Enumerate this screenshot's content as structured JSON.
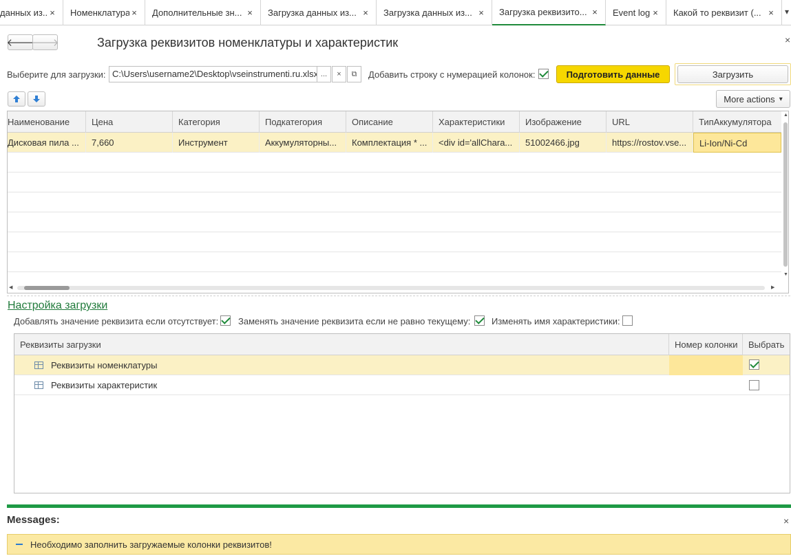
{
  "tabs": [
    {
      "label": "данных из...",
      "active": false
    },
    {
      "label": "Номенклатура",
      "active": false
    },
    {
      "label": "Дополнительные зн...",
      "active": false
    },
    {
      "label": "Загрузка данных из...",
      "active": false
    },
    {
      "label": "Загрузка данных из...",
      "active": false
    },
    {
      "label": "Загрузка реквизито...",
      "active": true
    },
    {
      "label": "Event log",
      "active": false
    },
    {
      "label": "Какой то реквизит (...",
      "active": false
    }
  ],
  "tab_close_glyph": "×",
  "tab_overflow_glyph": "▾",
  "window": {
    "title": "Загрузка реквизитов номенклатуры и характеристик",
    "close_glyph": "×"
  },
  "nav": {
    "back_glyph": "🡐",
    "forward_glyph": "🡒"
  },
  "file_row": {
    "label": "Выберите для загрузки:",
    "path": "C:\\Users\\username2\\Desktop\\vseinstrumenti.ru.xlsx",
    "select_glyph": "...",
    "clear_glyph": "×",
    "open_glyph": "⧉",
    "numbering_label": "Добавить строку с нумерацией колонок:",
    "numbering_checked": true,
    "prepare_button": "Подготовить данные",
    "load_button": "Загрузить"
  },
  "toolbar": {
    "more_actions": "More actions",
    "more_actions_arrow": "▾"
  },
  "grid": {
    "columns": [
      "Наименование",
      "Цена",
      "Категория",
      "Подкатегория",
      "Описание",
      "Характеристики",
      "Изображение",
      "URL",
      "ТипАккумулятора"
    ],
    "rows": [
      [
        "Дисковая пила ...",
        "7,660",
        "Инструмент",
        "Аккумуляторны...",
        "Комплектация * ...",
        "<div id='allChara...",
        "51002466.jpg",
        "https://rostov.vse...",
        "Li-Ion/Ni-Cd"
      ]
    ]
  },
  "settings": {
    "link": "Настройка загрузки",
    "add_if_missing_label": "Добавлять значение реквизита если отсутствует:",
    "add_if_missing": true,
    "replace_if_differs_label": "Заменять значение реквизита если не равно текущему:",
    "replace_if_differs": true,
    "rename_characteristic_label": "Изменять имя характеристики:",
    "rename_characteristic": false
  },
  "requisites": {
    "columns": [
      "Реквизиты загрузки",
      "Номер колонки",
      "Выбрать"
    ],
    "rows": [
      {
        "name": "Реквизиты номенклатуры",
        "column_no": "",
        "selected": true
      },
      {
        "name": "Реквизиты характеристик",
        "column_no": "",
        "selected": false
      }
    ]
  },
  "messages": {
    "title": "Messages:",
    "close_glyph": "×",
    "items": [
      "Необходимо заполнить загружаемые колонки реквизитов!"
    ]
  },
  "colors": {
    "accent_green": "#1e9a45",
    "highlight": "#fbf1c5",
    "button_yellow": "#f6d700",
    "message_bg": "#fbe9a3"
  }
}
